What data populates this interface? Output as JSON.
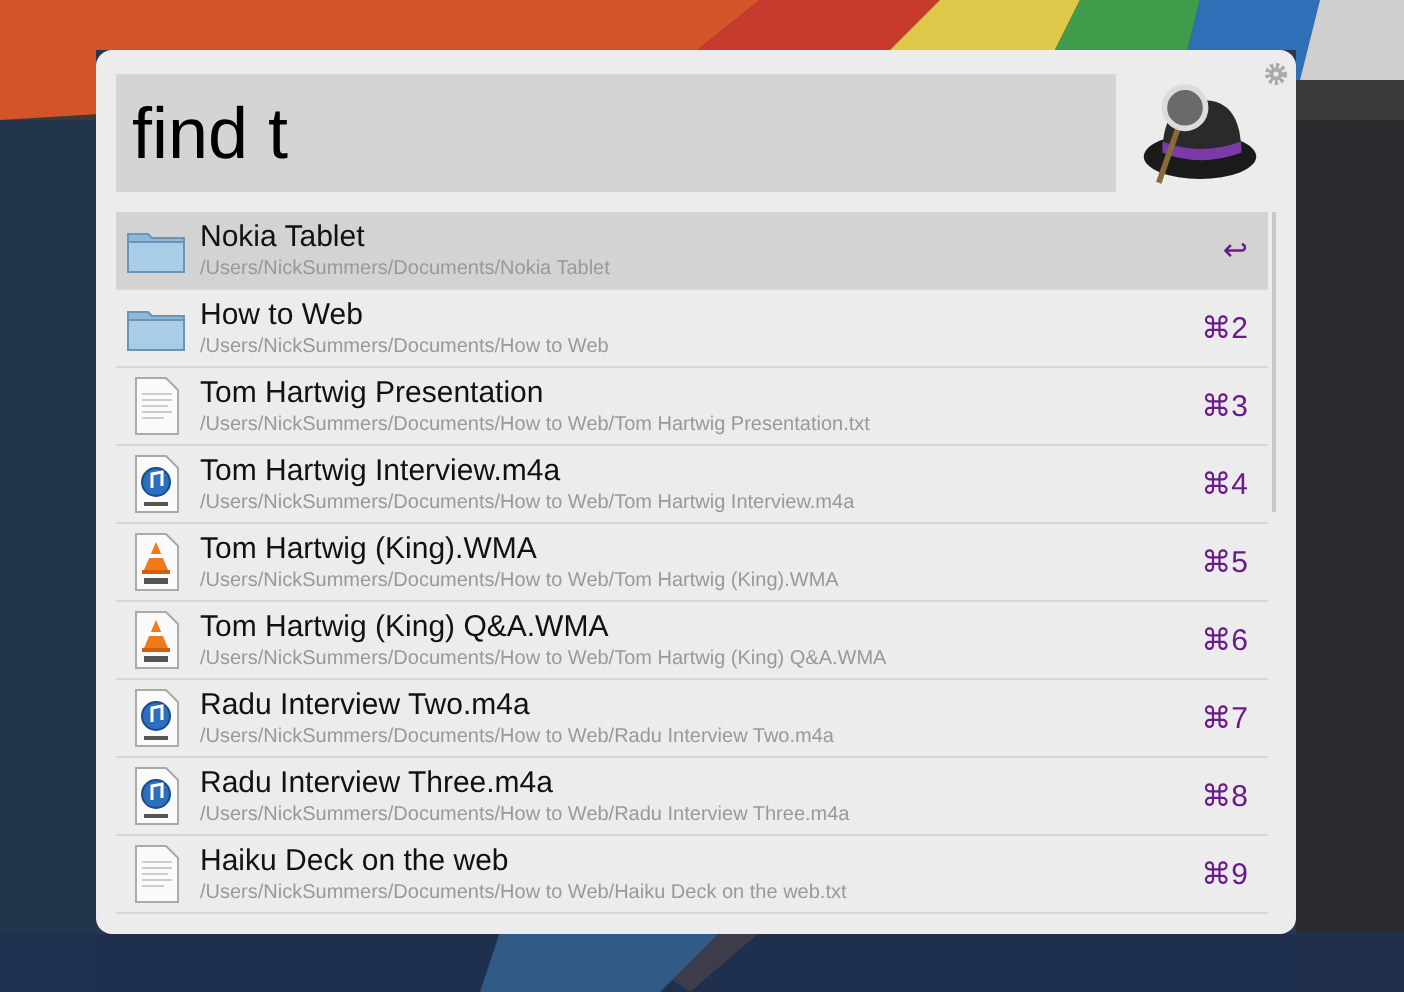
{
  "search": {
    "value": "find t"
  },
  "results": [
    {
      "title": "Nokia Tablet",
      "path": "/Users/NickSummers/Documents/Nokia Tablet",
      "kind": "folder",
      "shortcut": "↩",
      "selected": true
    },
    {
      "title": "How to Web",
      "path": "/Users/NickSummers/Documents/How to Web",
      "kind": "folder",
      "shortcut": "⌘2",
      "selected": false
    },
    {
      "title": "Tom Hartwig Presentation",
      "path": "/Users/NickSummers/Documents/How to Web/Tom Hartwig Presentation.txt",
      "kind": "text",
      "shortcut": "⌘3",
      "selected": false
    },
    {
      "title": "Tom Hartwig Interview.m4a",
      "path": "/Users/NickSummers/Documents/How to Web/Tom Hartwig Interview.m4a",
      "kind": "audio",
      "shortcut": "⌘4",
      "selected": false
    },
    {
      "title": "Tom Hartwig (King).WMA",
      "path": "/Users/NickSummers/Documents/How to Web/Tom Hartwig (King).WMA",
      "kind": "wma",
      "shortcut": "⌘5",
      "selected": false
    },
    {
      "title": "Tom Hartwig (King) Q&A.WMA",
      "path": "/Users/NickSummers/Documents/How to Web/Tom Hartwig (King) Q&A.WMA",
      "kind": "wma",
      "shortcut": "⌘6",
      "selected": false
    },
    {
      "title": "Radu Interview Two.m4a",
      "path": "/Users/NickSummers/Documents/How to Web/Radu Interview Two.m4a",
      "kind": "audio",
      "shortcut": "⌘7",
      "selected": false
    },
    {
      "title": "Radu Interview Three.m4a",
      "path": "/Users/NickSummers/Documents/How to Web/Radu Interview Three.m4a",
      "kind": "audio",
      "shortcut": "⌘8",
      "selected": false
    },
    {
      "title": "Haiku Deck on the web",
      "path": "/Users/NickSummers/Documents/How to Web/Haiku Deck on the web.txt",
      "kind": "text",
      "shortcut": "⌘9",
      "selected": false
    }
  ]
}
